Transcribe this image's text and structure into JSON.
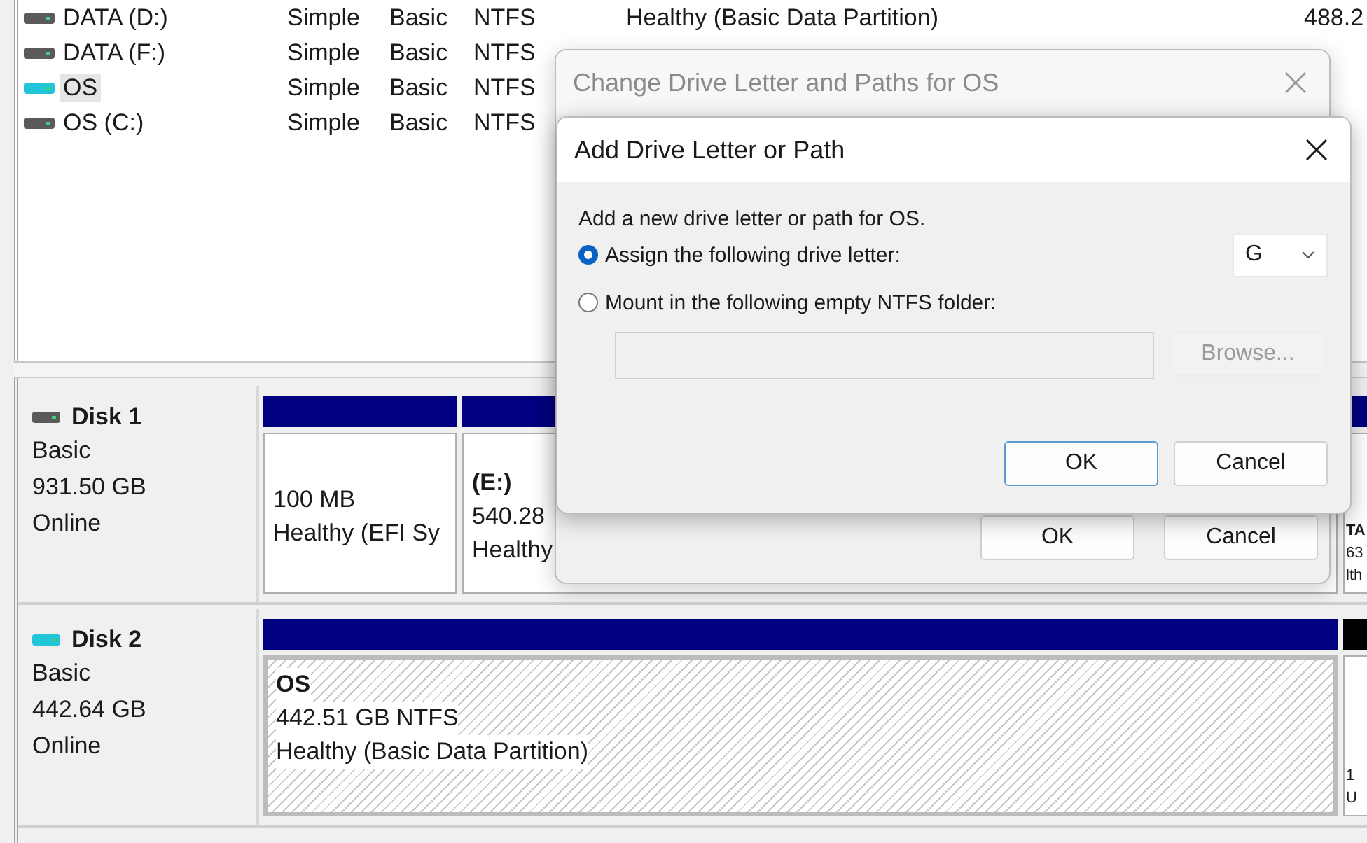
{
  "volumes": [
    {
      "name": "DATA (D:)",
      "color": "#5a5a5a",
      "selected": false,
      "layout": "Simple",
      "type": "Basic",
      "fs": "NTFS",
      "status": "Healthy (Basic Data Partition)",
      "capacity": "488.2"
    },
    {
      "name": "DATA (F:)",
      "color": "#5a5a5a",
      "selected": false,
      "layout": "Simple",
      "type": "Basic",
      "fs": "NTFS"
    },
    {
      "name": "OS",
      "color": "#22c4d8",
      "selected": true,
      "layout": "Simple",
      "type": "Basic",
      "fs": "NTFS"
    },
    {
      "name": "OS (C:)",
      "color": "#5a5a5a",
      "selected": false,
      "layout": "Simple",
      "type": "Basic",
      "fs": "NTFS"
    }
  ],
  "disks": [
    {
      "name": "Disk 1",
      "color": "#5a5a5a",
      "type": "Basic",
      "size": "931.50 GB",
      "status": "Online",
      "partitions": [
        {
          "kind": "efi",
          "hatched": false,
          "color": "#000080",
          "lines": [
            "100 MB",
            "Healthy (EFI Sy"
          ]
        },
        {
          "kind": "main",
          "hatched": false,
          "color": "#000080",
          "title": "(E:)",
          "lines": [
            "540.28",
            "Healthy"
          ]
        },
        {
          "kind": "edge",
          "hatched": false,
          "color": "#000080",
          "title": "TA",
          "lines": [
            "63",
            "lth"
          ]
        }
      ]
    },
    {
      "name": "Disk 2",
      "color": "#22c4d8",
      "type": "Basic",
      "size": "442.64 GB",
      "status": "Online",
      "partitions": [
        {
          "kind": "main",
          "hatched": true,
          "color": "#000080",
          "title": "OS",
          "lines": [
            "442.51 GB NTFS",
            "Healthy (Basic Data Partition)"
          ]
        },
        {
          "kind": "edge",
          "hatched": false,
          "color": "#000000",
          "lines": [
            "1",
            "U"
          ]
        }
      ]
    }
  ],
  "back_dialog": {
    "title": "Change Drive Letter and Paths for OS",
    "buttons": [
      "OK",
      "Cancel"
    ]
  },
  "dialog": {
    "title": "Add Drive Letter or Path",
    "intro": "Add a new drive letter or path for OS.",
    "options": [
      {
        "label": "Assign the following drive letter:",
        "selected": true
      },
      {
        "label": "Mount in the following empty NTFS folder:",
        "selected": false
      }
    ],
    "letter": "G",
    "browse": {
      "label": "Browse...",
      "disabled": true
    },
    "buttons": [
      "OK",
      "Cancel"
    ]
  }
}
